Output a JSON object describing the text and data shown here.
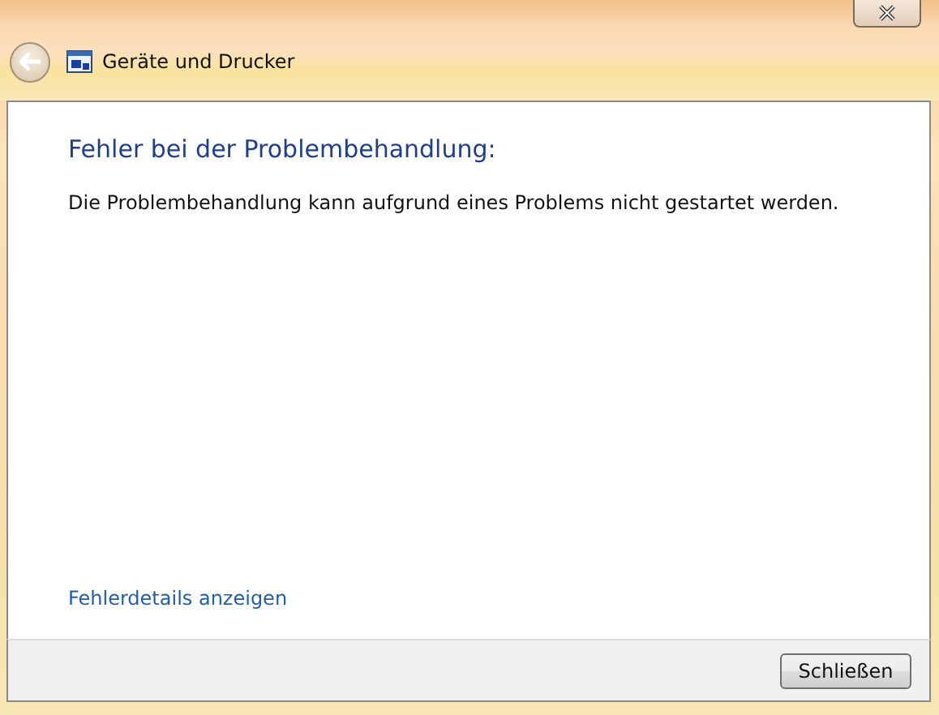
{
  "window": {
    "title": "Geräte und Drucker"
  },
  "heading": "Fehler bei der Problembehandlung:",
  "message": "Die Problembehandlung kann aufgrund eines Problems nicht gestartet werden.",
  "details_link": "Fehlerdetails anzeigen",
  "buttons": [
    "Schließen"
  ]
}
